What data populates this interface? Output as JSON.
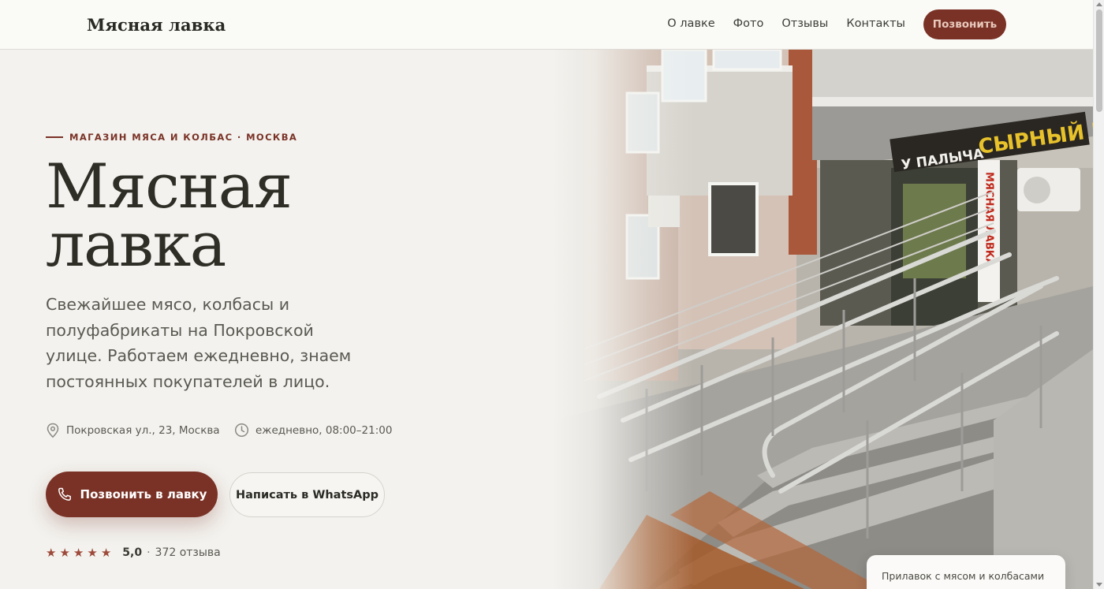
{
  "header": {
    "brand": "Мясная лавка",
    "nav": [
      "О лавке",
      "Фото",
      "Отзывы",
      "Контакты"
    ],
    "call_label": "Позвонить"
  },
  "hero": {
    "eyebrow": "МАГАЗИН МЯСА И КОЛБАС · МОСКВА",
    "title_line1": "Мясная",
    "title_line2": "лавка",
    "lead": "Свежайшее мясо, колбасы и полуфабрикаты на Покровской улице. Работаем ежедневно, знаем постоянных покупателей в лицо.",
    "address": "Покровская ул., 23, Москва",
    "hours": "ежедневно, 08:00–21:00",
    "primary_button": "Позвонить в лавку",
    "secondary_button": "Написать в WhatsApp",
    "rating_value": "5,0",
    "rating_sep": "·",
    "rating_count": "372 отзыва",
    "stars": 5,
    "photo_caption": "Прилавок с мясом и колбасами в"
  },
  "photo_signage": {
    "sign_main": "СЫРНЫЙ РЯД",
    "sign_left": "У ПАЛЫЧА",
    "sign_vertical": "МЯСНАЯ ЛАВКА"
  },
  "icons": {
    "address": "map-pin-icon",
    "hours": "clock-icon",
    "phone": "phone-icon",
    "star": "star-icon"
  },
  "colors": {
    "accent": "#7a3226",
    "background": "#f3f2ee",
    "text": "#2e2e26"
  }
}
